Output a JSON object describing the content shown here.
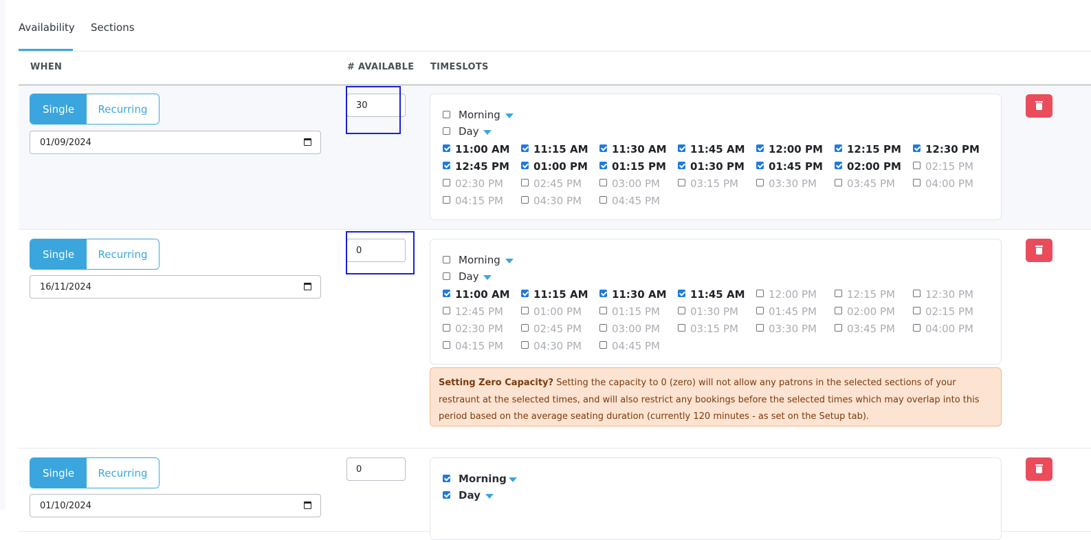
{
  "tabs": {
    "availability": "Availability",
    "sections": "Sections"
  },
  "columns": {
    "when": "WHEN",
    "available": "# AVAILABLE",
    "timeslots": "TIMESLOTS"
  },
  "mode_labels": {
    "single": "Single",
    "recurring": "Recurring"
  },
  "groups": {
    "morning": "Morning",
    "day": "Day"
  },
  "timeslots": [
    "11:00 AM",
    "11:15 AM",
    "11:30 AM",
    "11:45 AM",
    "12:00 PM",
    "12:15 PM",
    "12:30 PM",
    "12:45 PM",
    "01:00 PM",
    "01:15 PM",
    "01:30 PM",
    "01:45 PM",
    "02:00 PM",
    "02:15 PM",
    "02:30 PM",
    "02:45 PM",
    "03:00 PM",
    "03:15 PM",
    "03:30 PM",
    "03:45 PM",
    "04:00 PM",
    "04:15 PM",
    "04:30 PM",
    "04:45 PM"
  ],
  "rows": [
    {
      "date": "01/09/2024",
      "available": "30",
      "mode": "Single",
      "morning_checked": false,
      "day_checked": false,
      "checked_slot_count": 13
    },
    {
      "date": "16/11/2024",
      "available": "0",
      "mode": "Single",
      "morning_checked": false,
      "day_checked": false,
      "checked_slot_count": 4,
      "warning": {
        "title": "Setting Zero Capacity?",
        "text": "Setting the capacity to 0 (zero) will not allow any patrons in the selected sections of your restraunt at the selected times, and will also restrict any bookings before the selected times which may overlap into this period based on the average seating duration (currently 120 minutes - as set on the Setup tab)."
      }
    },
    {
      "date": "01/10/2024",
      "available": "0",
      "mode": "Single",
      "morning_checked": true,
      "day_checked": true
    }
  ],
  "colors": {
    "accent": "#3aa6dd",
    "danger": "#ea4c5c",
    "warning_bg": "#fde3d2",
    "checkbox": "#1f7ae0",
    "highlight": "#1a1fd6"
  },
  "icons": {
    "delete": "trash-icon",
    "date": "calendar-icon",
    "group_toggle": "caret-down-icon"
  }
}
